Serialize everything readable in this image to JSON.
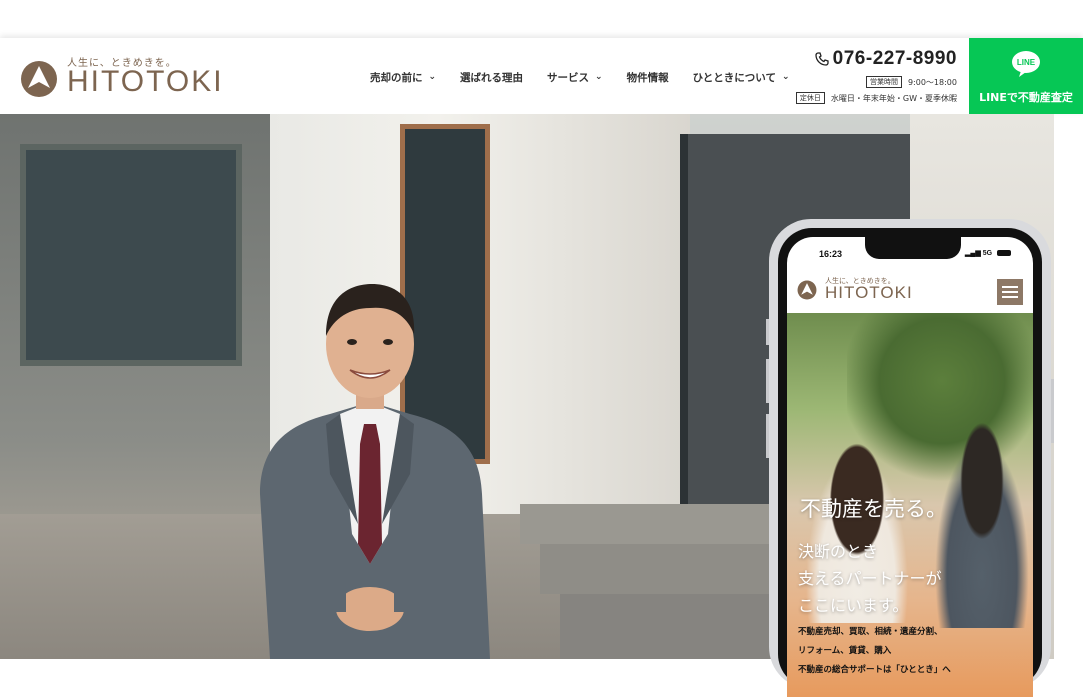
{
  "header": {
    "logo": {
      "tagline": "人生に、ときめきを。",
      "name": "HITOTOKI"
    },
    "nav": [
      {
        "label": "売却の前に",
        "has_dropdown": true
      },
      {
        "label": "選ばれる理由",
        "has_dropdown": false
      },
      {
        "label": "サービス",
        "has_dropdown": true
      },
      {
        "label": "物件情報",
        "has_dropdown": false
      },
      {
        "label": "ひとときについて",
        "has_dropdown": true
      }
    ],
    "contact": {
      "phone": "076-227-8990",
      "hours_tag": "営業時間",
      "hours": "9:00〜18:00",
      "closed_tag": "定休日",
      "closed": "水曜日・年末年始・GW・夏季休暇"
    },
    "line_button": {
      "icon_text": "LINE",
      "label": "LINEで不動産査定",
      "color": "#06c755"
    }
  },
  "mobile": {
    "status": {
      "time": "16:23",
      "network": "5G"
    },
    "logo": {
      "tagline": "人生に、ときめきを。",
      "name": "HITOTOKI"
    },
    "hero": {
      "headline": "不動産を売る。",
      "lines": [
        "決断のとき",
        "支えるパートナーが",
        "ここにいます。"
      ],
      "sub_lines": [
        "不動産売却、買取、相続・遺産分割、",
        "リフォーム、賃貸、購入",
        "不動産の総合サポートは「ひととき」へ"
      ]
    }
  },
  "colors": {
    "brand": "#7d6550",
    "line": "#06c755"
  }
}
